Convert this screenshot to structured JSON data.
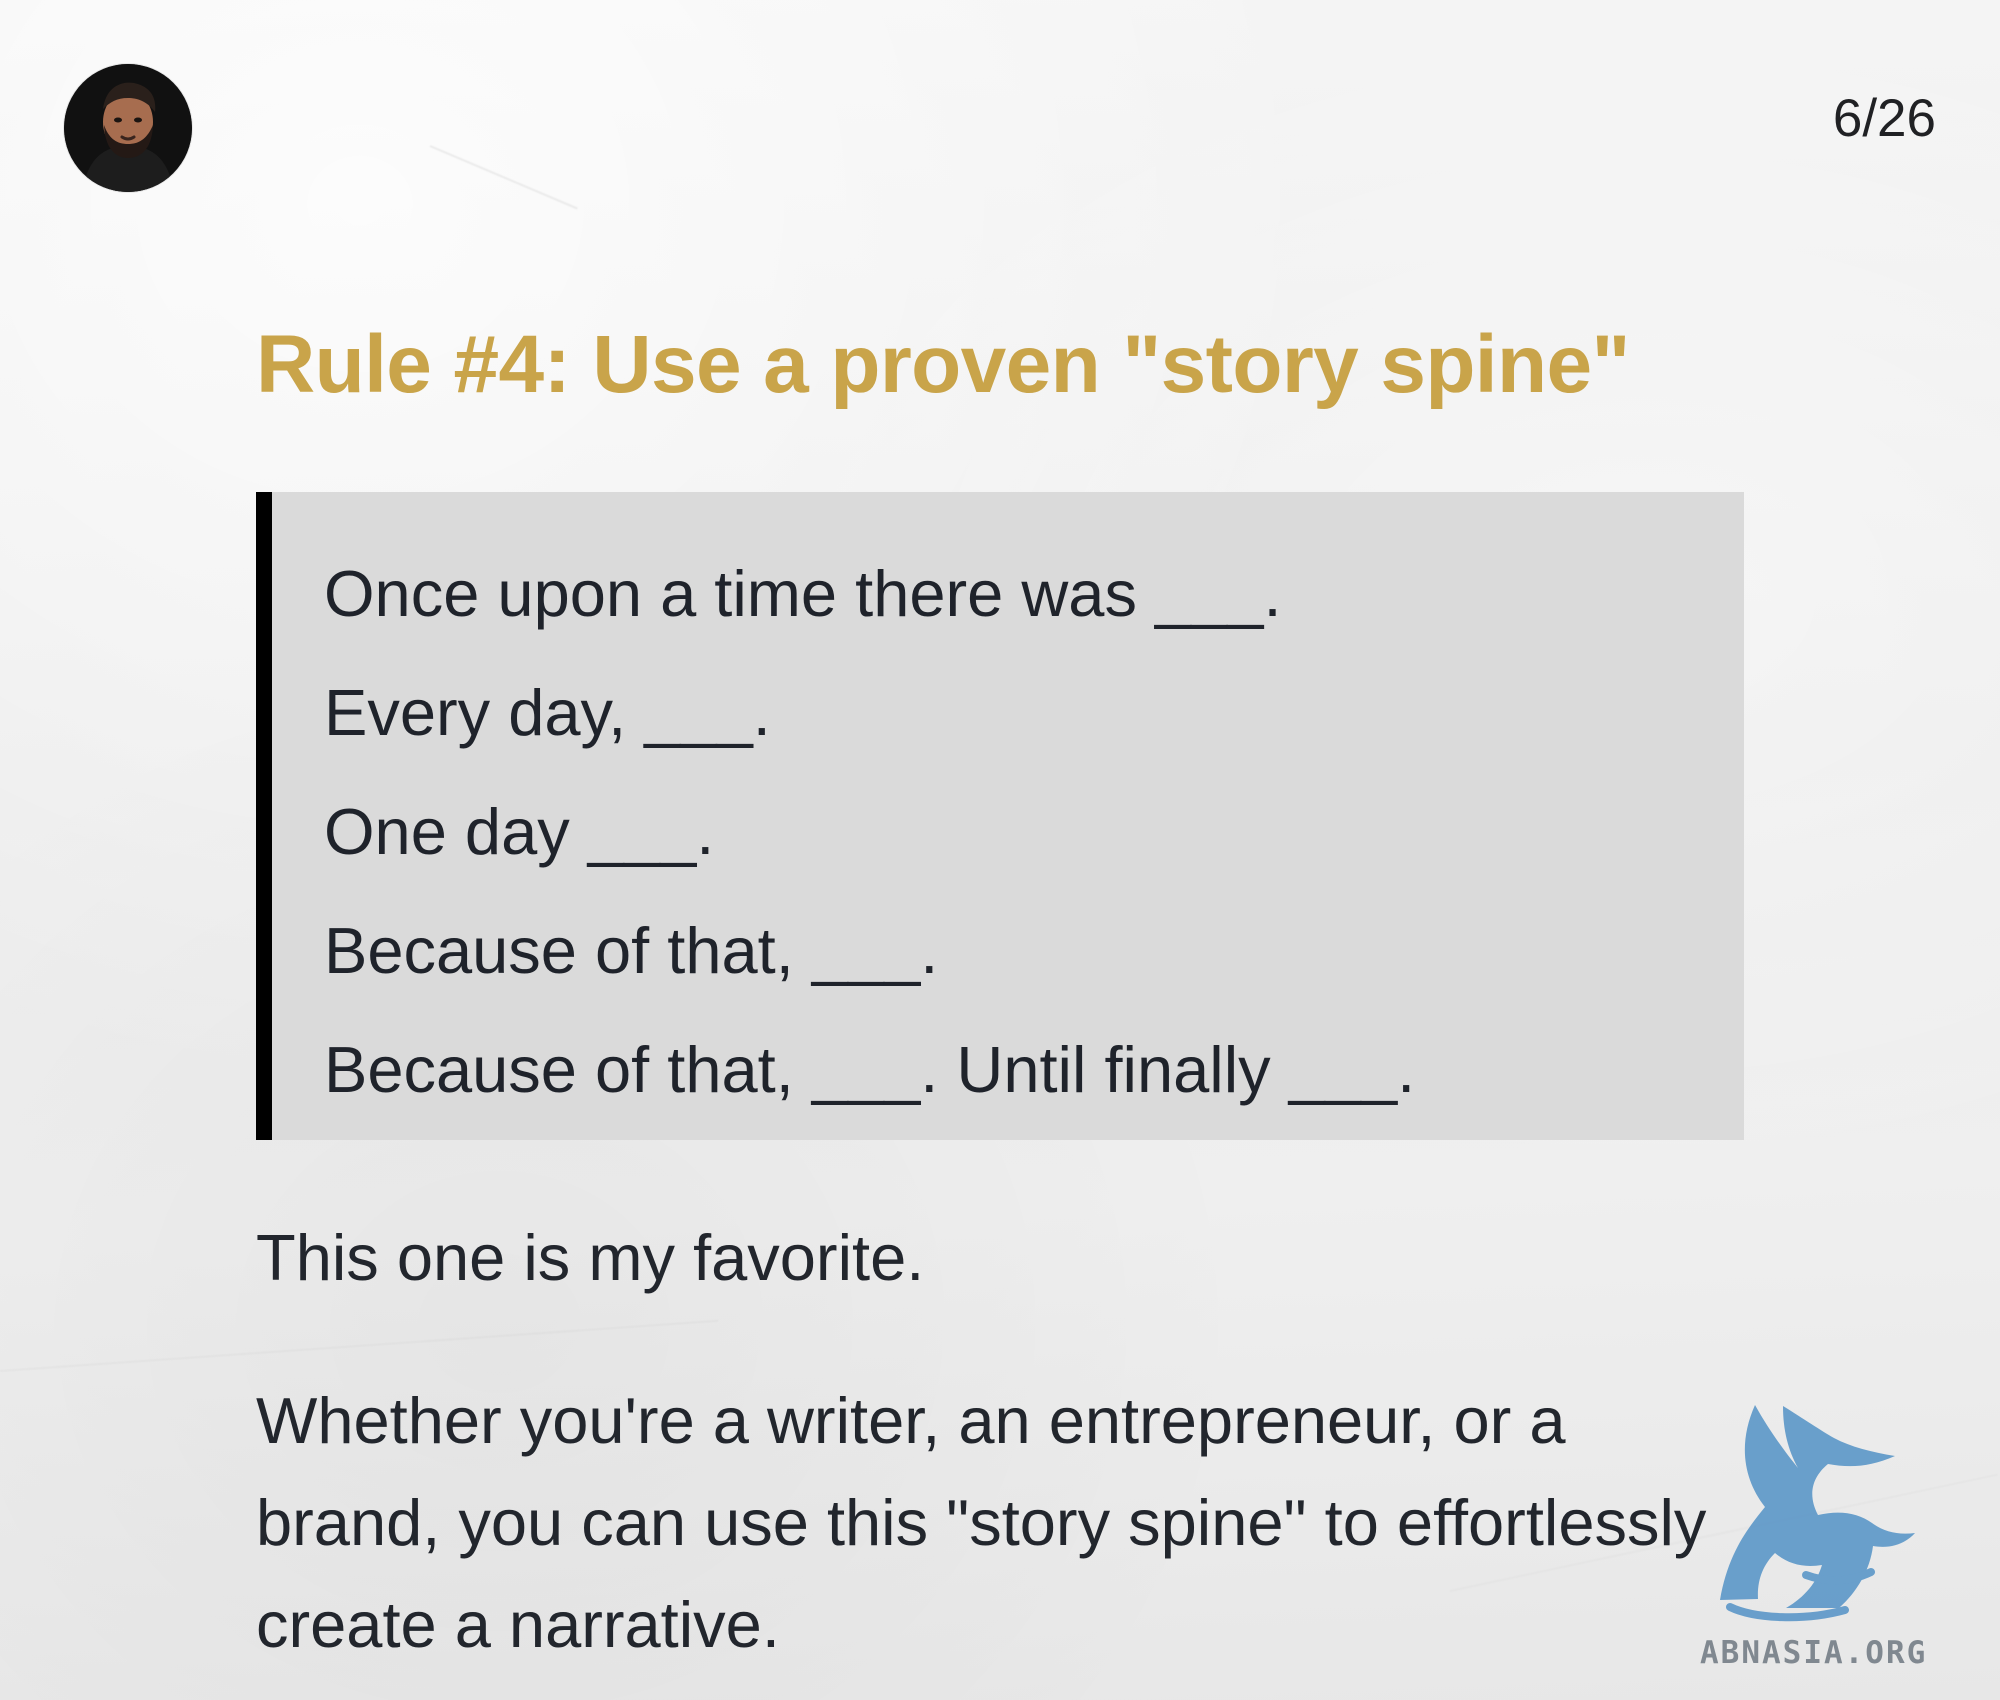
{
  "page_indicator": "6/26",
  "title": "Rule #4: Use a proven \"story spine\"",
  "story_spine": [
    "Once upon a time there was ___.",
    "Every day, ___.",
    "One day ___.",
    "Because of that, ___.",
    "Because of that, ___. Until finally ___."
  ],
  "body": {
    "favorite": "This one is my favorite.",
    "paragraph": "Whether you're a writer, an entrepreneur, or a brand, you can use this \"story spine\" to effortlessly create a narrative."
  },
  "watermark": {
    "text": "ABNASIA.ORG",
    "icon": "griffin-icon",
    "color": "#5c97c8"
  },
  "colors": {
    "accent": "#c9a44a",
    "quote_background": "#dadada",
    "quote_bar": "#000000",
    "text": "#1f232b"
  }
}
